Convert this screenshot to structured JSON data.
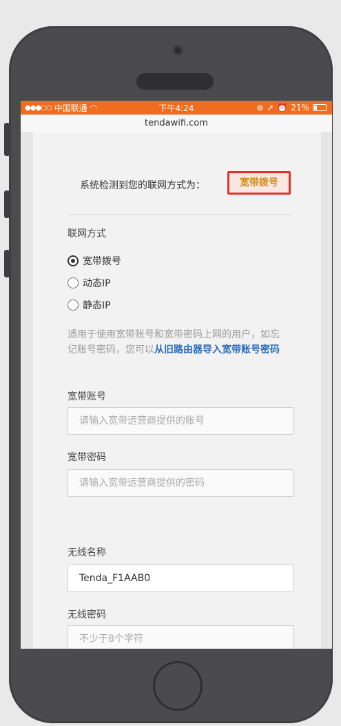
{
  "status_bar": {
    "carrier": "中国联通",
    "time": "下午4:24",
    "battery": "21%"
  },
  "browser": {
    "url": "tendawifi.com"
  },
  "detection": {
    "text": "系统检测到您的联网方式为：",
    "value": "宽带拨号"
  },
  "connection": {
    "label": "联网方式",
    "options": [
      {
        "label": "宽带拨号",
        "checked": true
      },
      {
        "label": "动态IP",
        "checked": false
      },
      {
        "label": "静态IP",
        "checked": false
      }
    ]
  },
  "hint": {
    "text": "适用于使用宽带账号和宽带密码上网的用户，如忘记账号密码，您可以",
    "link": "从旧路由器导入宽带账号密码"
  },
  "broadband_account": {
    "label": "宽带账号",
    "placeholder": "请输入宽带运营商提供的账号"
  },
  "broadband_password": {
    "label": "宽带密码",
    "placeholder": "请输入宽带运营商提供的密码"
  },
  "wifi_name": {
    "label": "无线名称",
    "value": "Tenda_F1AAB0"
  },
  "wifi_password": {
    "label": "无线密码",
    "placeholder": "不少于8个字符"
  },
  "colors": {
    "status_bar": "#f06c1e",
    "highlight_border": "#e0322a",
    "link": "#2a6dbb"
  }
}
